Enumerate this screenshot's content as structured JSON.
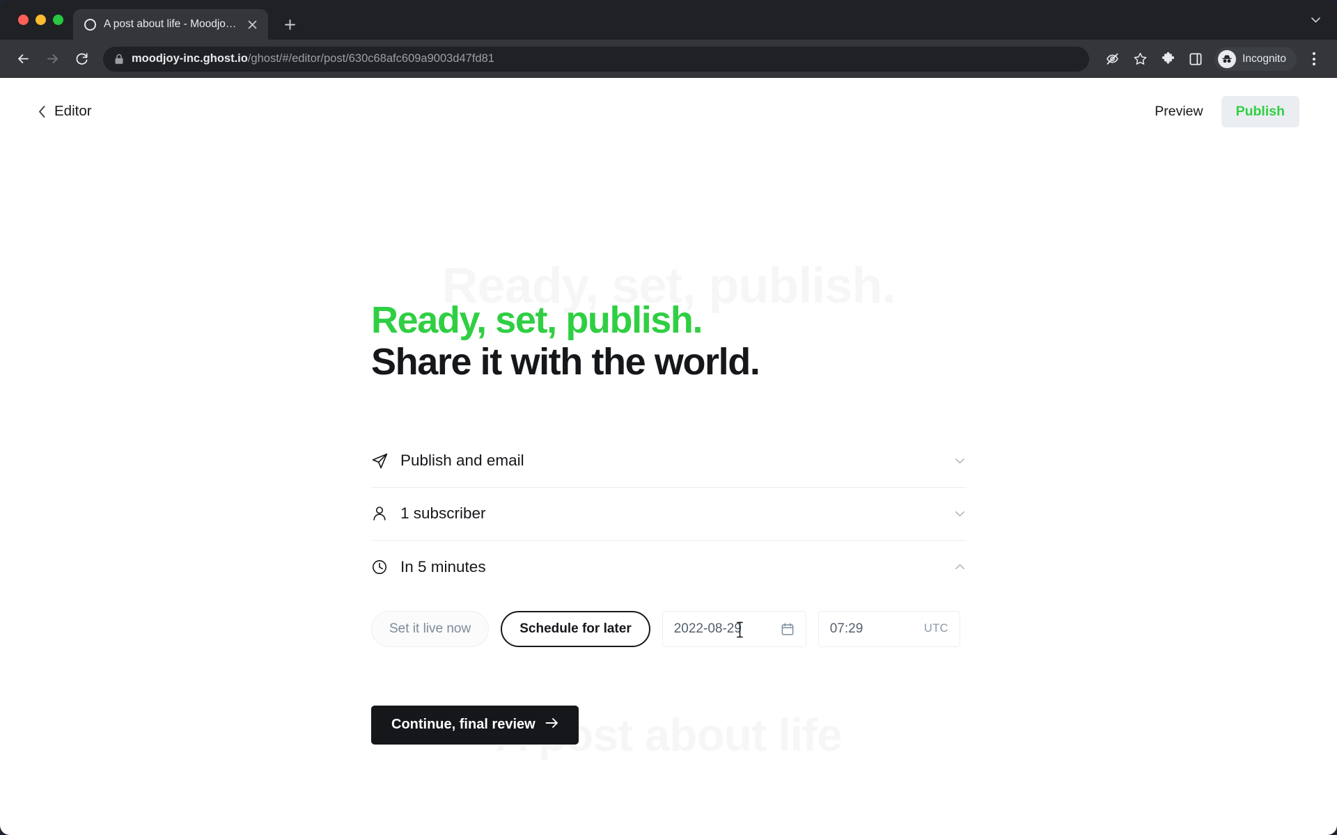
{
  "browser": {
    "tab": {
      "title": "A post about life - Moodjoy Inc",
      "favicon": "ghost-logo-icon",
      "close": "close-icon"
    },
    "new_tab": "+",
    "tab_list_chevron": "chevron-down-icon",
    "nav": {
      "back": "back-arrow-icon",
      "forward": "forward-arrow-icon",
      "reload": "reload-icon"
    },
    "omnibox": {
      "lock": "lock-icon",
      "host": "moodjoy-inc.ghost.io",
      "path": "/ghost/#/editor/post/630c68afc609a9003d47fd81",
      "full_url": "moodjoy-inc.ghost.io/ghost/#/editor/post/630c68afc609a9003d47fd81"
    },
    "actions": {
      "tracking_protection": "eye-slash-icon",
      "bookmark": "star-icon",
      "extensions": "puzzle-icon",
      "side_panel": "side-panel-icon",
      "profile_label": "Incognito",
      "profile_avatar": "incognito-avatar-icon",
      "menu": "three-dots-icon"
    }
  },
  "app": {
    "back_label": "Editor",
    "preview_label": "Preview",
    "publish_label": "Publish",
    "accent_green": "#30cf43",
    "ink": "#15171a",
    "background_watermark_top": "Ready, set, publish.",
    "background_watermark_bottom": "A post about life"
  },
  "main": {
    "headline_green": "Ready, set, publish.",
    "headline_dark": "Share it with the world.",
    "settings": [
      {
        "icon": "paper-plane-icon",
        "label": "Publish and email",
        "chevron": "chevron-down-icon",
        "expanded": false
      },
      {
        "icon": "person-icon",
        "label": "1 subscriber",
        "chevron": "chevron-down-icon",
        "expanded": false
      },
      {
        "icon": "clock-icon",
        "label": "In 5 minutes",
        "chevron": "chevron-up-icon",
        "expanded": true
      }
    ],
    "schedule": {
      "set_live_label": "Set it live now",
      "schedule_later_label": "Schedule for later",
      "selected": "Schedule for later",
      "date_value": "2022-08-29",
      "date_icon": "calendar-icon",
      "time_value": "07:29",
      "timezone": "UTC"
    },
    "continue_label": "Continue, final review",
    "continue_arrow": "arrow-right-icon"
  }
}
